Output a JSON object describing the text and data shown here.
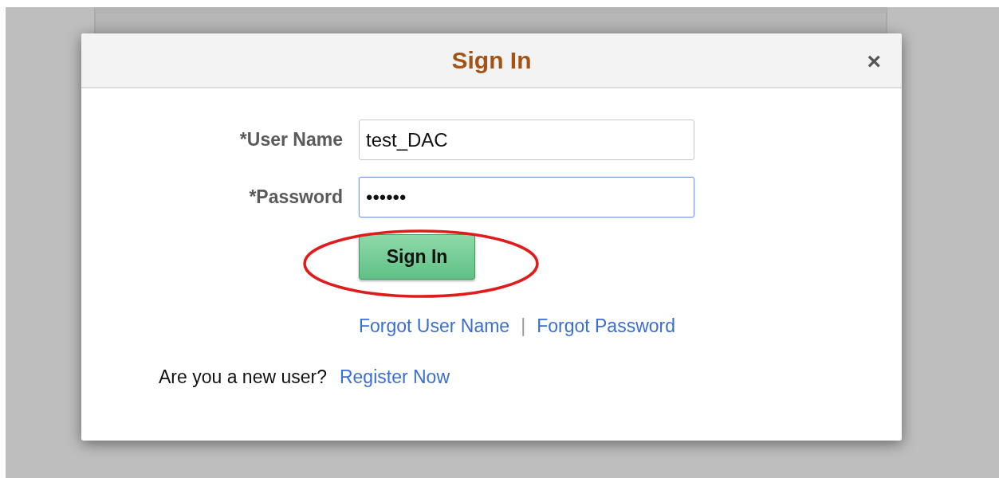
{
  "dialog": {
    "title": "Sign In",
    "close": "×"
  },
  "fields": [
    {
      "label": "*User Name",
      "value": "test_DAC",
      "focused": false
    },
    {
      "label": "*Password",
      "value": "••••••",
      "focused": true
    }
  ],
  "sign_in_button": {
    "label": "Sign In",
    "highlighted": true
  },
  "links": [
    "Forgot User Name",
    "Forgot Password"
  ],
  "separator": "|",
  "register": {
    "prompt": "Are you a new user?",
    "link": "Register Now"
  }
}
